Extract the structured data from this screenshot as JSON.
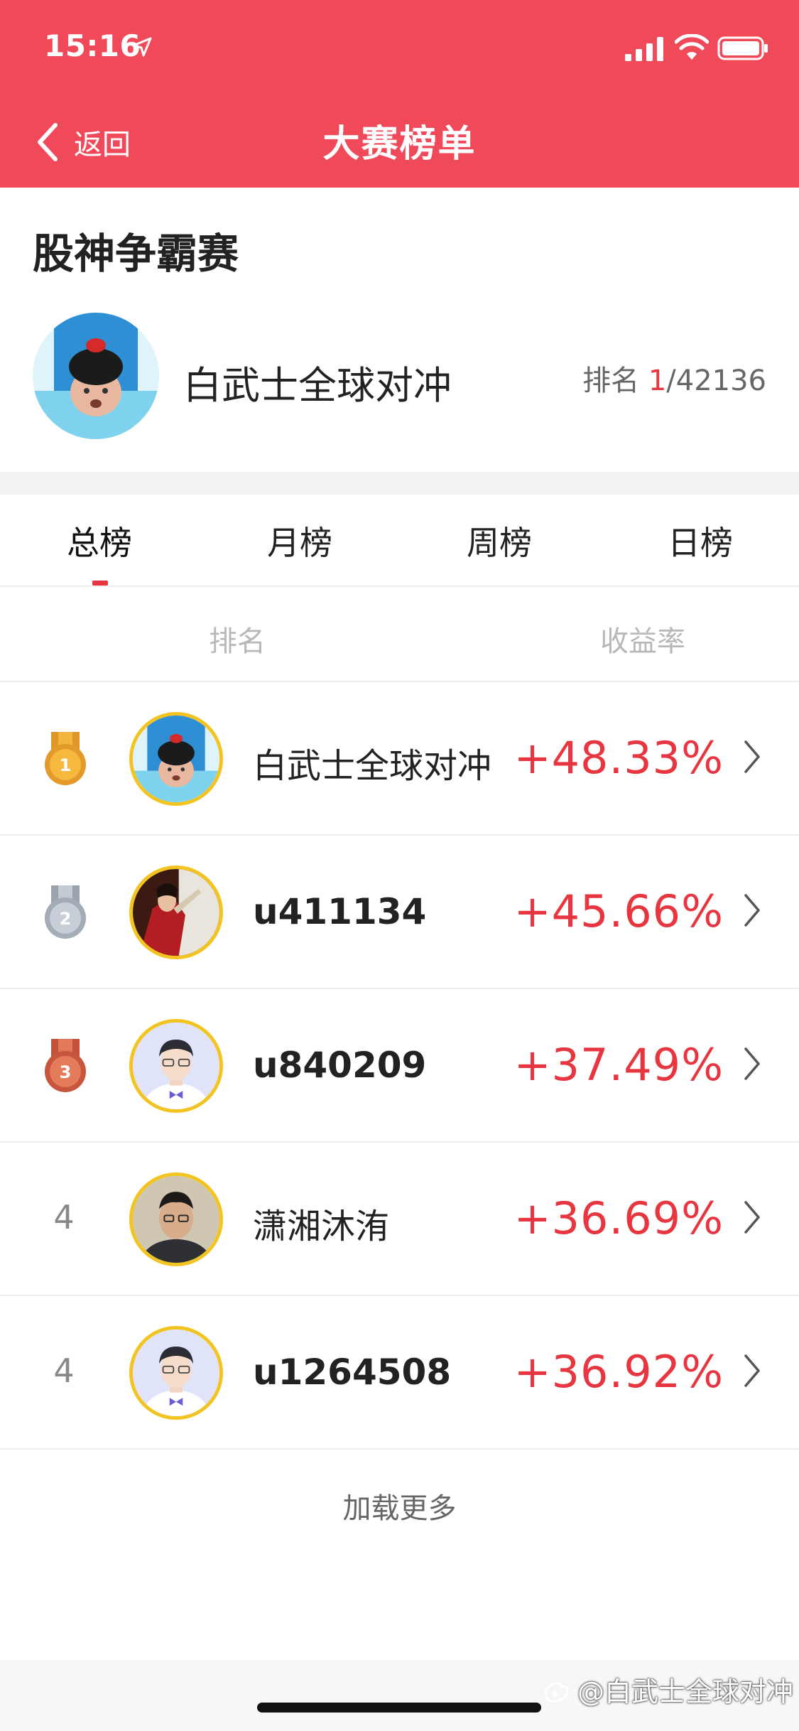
{
  "status_bar": {
    "time": "15:16"
  },
  "nav": {
    "back_label": "返回",
    "title": "大赛榜单"
  },
  "contest": {
    "title": "股神争霸赛"
  },
  "profile": {
    "name": "白武士全球对冲",
    "rank_label": "排名",
    "rank_value": "1",
    "rank_total": "/42136"
  },
  "tabs": [
    {
      "label": "总榜",
      "active": true
    },
    {
      "label": "月榜",
      "active": false
    },
    {
      "label": "周榜",
      "active": false
    },
    {
      "label": "日榜",
      "active": false
    }
  ],
  "columns": {
    "rank": "排名",
    "yield": "收益率"
  },
  "rows": [
    {
      "rank": "1",
      "badge": "gold-medal-icon",
      "name": "白武士全球对冲",
      "yield": "+48.33%",
      "avatar": "baby-photo"
    },
    {
      "rank": "2",
      "badge": "silver-medal-icon",
      "name": "u411134",
      "yield": "+45.66%",
      "avatar": "woman-photo"
    },
    {
      "rank": "3",
      "badge": "bronze-medal-icon",
      "name": "u840209",
      "yield": "+37.49%",
      "avatar": "default-male-avatar"
    },
    {
      "rank": "4",
      "badge": "",
      "name": "潇湘沐洧",
      "yield": "+36.69%",
      "avatar": "man-photo"
    },
    {
      "rank": "4",
      "badge": "",
      "name": "u1264508",
      "yield": "+36.92%",
      "avatar": "default-male-avatar"
    }
  ],
  "load_more": "加载更多",
  "watermark": "@白武士全球对冲",
  "colors": {
    "header_bg": "#f04a5a",
    "accent_red": "#e7363f",
    "avatar_ring": "#f3c320"
  }
}
